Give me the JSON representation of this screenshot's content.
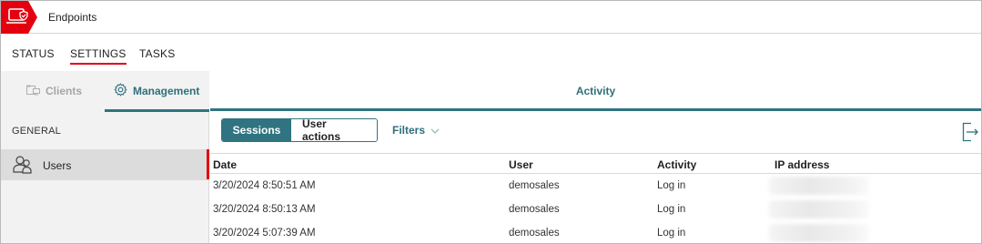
{
  "app": {
    "title": "Endpoints",
    "brand_color": "#e3000f",
    "accent_color": "#2f7480",
    "logo_icon": "shield-check-icon"
  },
  "top_tabs": [
    {
      "label": "STATUS",
      "active": false
    },
    {
      "label": "SETTINGS",
      "active": true
    },
    {
      "label": "TASKS",
      "active": false
    }
  ],
  "left_panel": {
    "subtabs": [
      {
        "label": "Clients",
        "icon": "folder-computer-icon",
        "active": false
      },
      {
        "label": "Management",
        "icon": "gear-icon",
        "active": true
      }
    ],
    "section": "GENERAL",
    "items": [
      {
        "label": "Users",
        "icon": "users-icon",
        "selected": true
      }
    ]
  },
  "main": {
    "header": "Activity",
    "segments": [
      {
        "label": "Sessions",
        "active": true
      },
      {
        "label": "User actions",
        "active": false
      }
    ],
    "filters_label": "Filters",
    "export_icon": "export-icon",
    "table": {
      "columns": [
        "Date",
        "User",
        "Activity",
        "IP address"
      ],
      "rows": [
        {
          "date": "3/20/2024 8:50:51 AM",
          "user": "demosales",
          "activity": "Log in"
        },
        {
          "date": "3/20/2024 8:50:13 AM",
          "user": "demosales",
          "activity": "Log in"
        },
        {
          "date": "3/20/2024 5:07:39 AM",
          "user": "demosales",
          "activity": "Log in"
        }
      ]
    }
  }
}
